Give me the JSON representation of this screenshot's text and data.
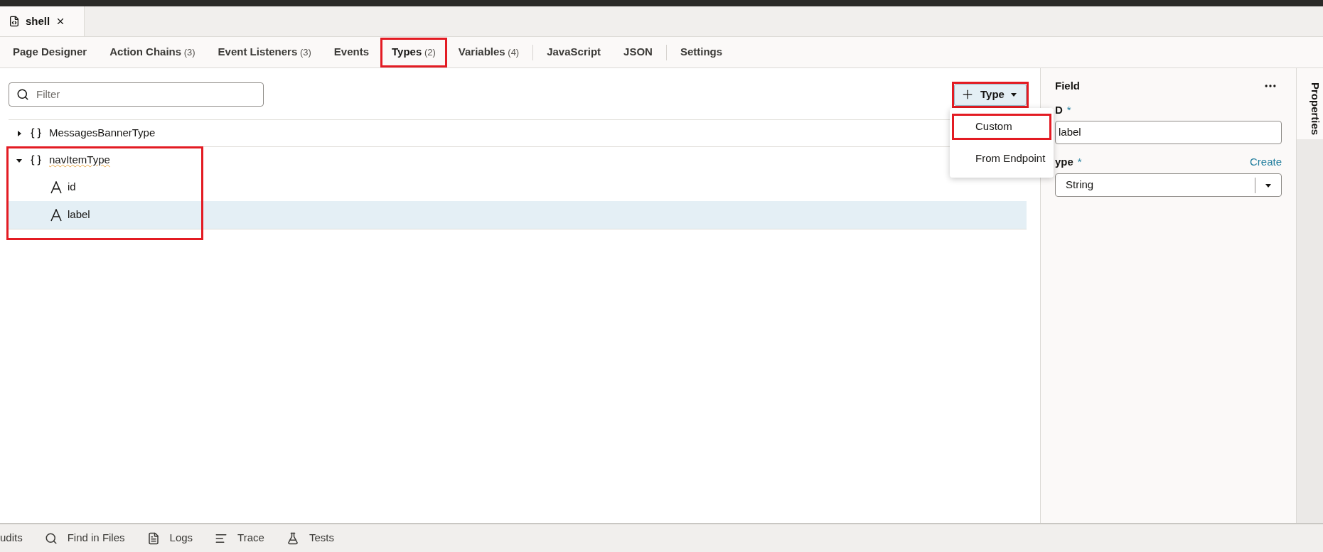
{
  "document_tab": {
    "title": "shell"
  },
  "tabs": [
    {
      "label": "Page Designer",
      "selected": false,
      "highlighted": false
    },
    {
      "label": "Action Chains",
      "count": "(3)",
      "selected": false,
      "highlighted": false
    },
    {
      "label": "Event Listeners",
      "count": "(3)",
      "selected": false,
      "highlighted": false
    },
    {
      "label": "Events",
      "selected": false,
      "highlighted": false
    },
    {
      "label": "Types",
      "count": "(2)",
      "selected": true,
      "highlighted": true
    },
    {
      "label": "Variables",
      "count": "(4)",
      "selected": false,
      "highlighted": false,
      "divider_after": true
    },
    {
      "label": "JavaScript",
      "selected": false,
      "highlighted": false
    },
    {
      "label": "JSON",
      "selected": false,
      "highlighted": false,
      "divider_after": true
    },
    {
      "label": "Settings",
      "selected": false,
      "highlighted": false
    }
  ],
  "filter": {
    "placeholder": "Filter"
  },
  "add_button": {
    "label": "Type",
    "highlighted": true
  },
  "add_menu": [
    {
      "label": "Custom",
      "highlighted": true
    },
    {
      "label": "From Endpoint",
      "highlighted": false
    }
  ],
  "types": [
    {
      "name": "MessagesBannerType",
      "expanded": false,
      "selected": false,
      "highlighted": false
    },
    {
      "name": "navItemType",
      "expanded": true,
      "selected": false,
      "highlighted": true,
      "children": [
        {
          "name": "id",
          "selected": false
        },
        {
          "name": "label",
          "selected": true
        }
      ]
    }
  ],
  "properties": {
    "title": "Field",
    "id_label": "D",
    "id_value": "label",
    "type_label": "ype",
    "required_mark": "*",
    "create_link": "Create",
    "type_value": "String",
    "side_tab": "Properties"
  },
  "bottom_bar": [
    {
      "label": "udits",
      "kind": "plain"
    },
    {
      "label": "Find in Files",
      "kind": "search"
    },
    {
      "label": "Logs",
      "kind": "logs"
    },
    {
      "label": "Trace",
      "kind": "trace"
    },
    {
      "label": "Tests",
      "kind": "tests"
    }
  ]
}
